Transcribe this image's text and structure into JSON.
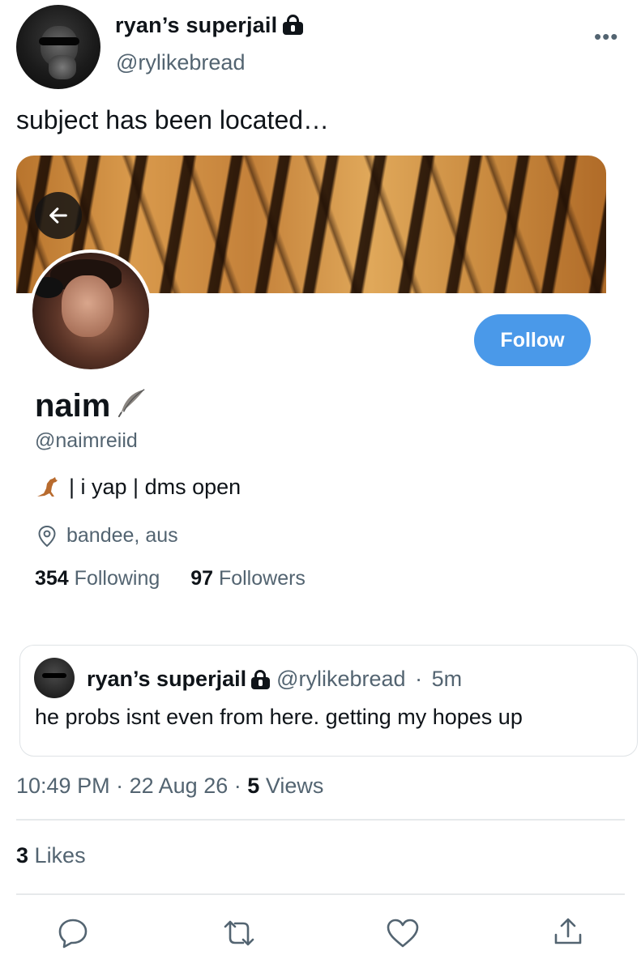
{
  "tweet": {
    "author_name": "ryan’s superjail",
    "author_handle": "@rylikebread",
    "text": "subject has been located…",
    "more_icon": "more-horizontal-icon"
  },
  "profile_card": {
    "display_name": "naim",
    "username": "@naimreiid",
    "bio": "| i yap | dms open",
    "bio_emoji": "kangaroo-icon",
    "location": "bandee, aus",
    "following_count": "354",
    "following_label": "Following",
    "followers_count": "97",
    "followers_label": "Followers",
    "follow_button": "Follow",
    "follow_color": "#4a99e9"
  },
  "quoted_tweet": {
    "author_name": "ryan’s superjail",
    "author_handle": "@rylikebread",
    "separator": "·",
    "time": "5m",
    "text": "he probs isnt even from here. getting my hopes up"
  },
  "meta": {
    "time": "10:49 PM",
    "date": "22 Aug 26",
    "views_count": "5",
    "views_label": "Views",
    "separator": "·"
  },
  "likes": {
    "count": "3",
    "label": "Likes"
  },
  "actions": [
    "reply-icon",
    "retweet-icon",
    "like-icon",
    "share-icon"
  ]
}
